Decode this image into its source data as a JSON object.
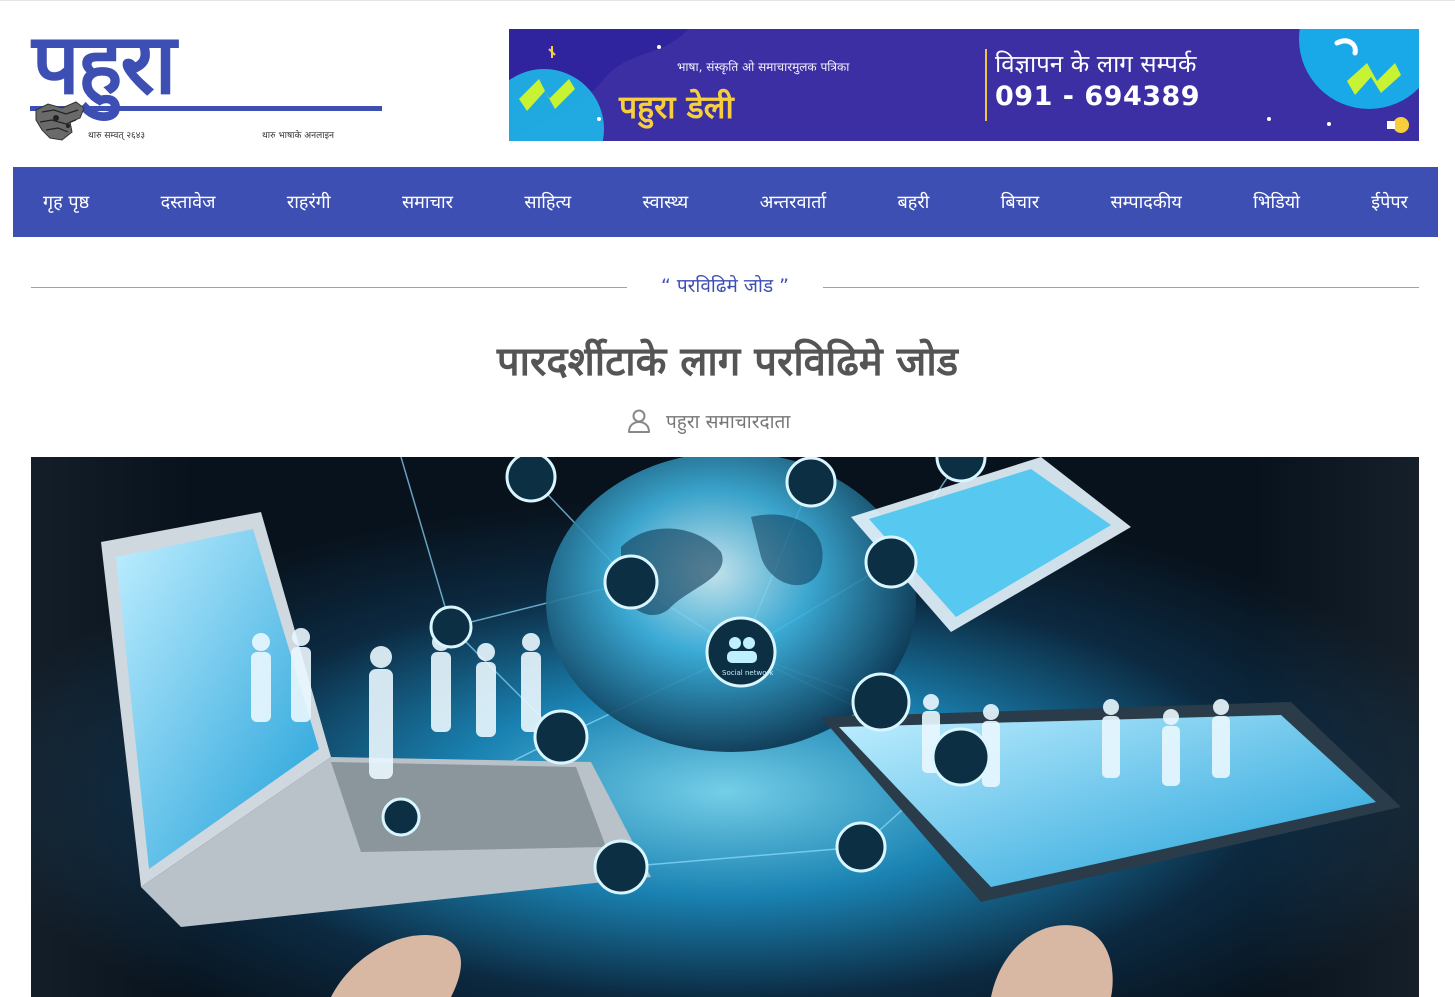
{
  "header": {
    "logo_text": "पहुरा",
    "logo_sub_left": "थारु सम्वत् २६४३",
    "logo_sub_right": "थारु भाषाके अनलाइन",
    "banner": {
      "tagline": "भाषा, संस्कृति ओ समाचारमुलक पत्रिका",
      "brand": "पहुरा डेली",
      "contact_label": "विज्ञापन के लाग सम्पर्क",
      "phone": "091 - 694389"
    }
  },
  "nav": {
    "items": [
      {
        "label": "गृह पृष्ठ"
      },
      {
        "label": "दस्तावेज"
      },
      {
        "label": "राहरंगी"
      },
      {
        "label": "समाचार"
      },
      {
        "label": "साहित्य"
      },
      {
        "label": "स्वास्थ्य"
      },
      {
        "label": "अन्तरवार्ता"
      },
      {
        "label": "बहरी"
      },
      {
        "label": "बिचार"
      },
      {
        "label": "सम्पादकीय"
      },
      {
        "label": "भिडियो"
      },
      {
        "label": "ईपेपर"
      }
    ]
  },
  "article": {
    "category": "“ परविढिमे जोड ”",
    "title": "पारदर्शीटाके लाग परविढिमे जोड",
    "author": "पहुरा समाचारदाता",
    "hero_icon_labels": [
      "Social network"
    ]
  },
  "colors": {
    "brand_blue": "#3d4fb3",
    "banner_purple": "#3b2fa3",
    "banner_accent": "#f7cf3c",
    "divider_tan": "#c79a6a"
  },
  "icons": {
    "byline": "user-icon"
  }
}
